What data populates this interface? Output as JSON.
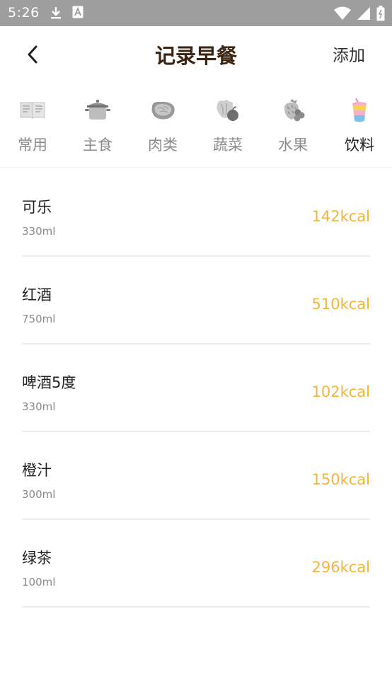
{
  "status_bar": {
    "time": "5:26",
    "left_icons": [
      "download-icon",
      "font-icon"
    ],
    "right_icons": [
      "wifi-icon",
      "signal-icon",
      "battery-icon"
    ]
  },
  "header": {
    "back_icon": "chevron-left-icon",
    "title": "记录早餐",
    "action_label": "添加"
  },
  "tabs": [
    {
      "label": "常用",
      "icon": "book-icon",
      "active": false
    },
    {
      "label": "主食",
      "icon": "rice-pot-icon",
      "active": false
    },
    {
      "label": "肉类",
      "icon": "steak-icon",
      "active": false
    },
    {
      "label": "蔬菜",
      "icon": "vegetables-icon",
      "active": false
    },
    {
      "label": "水果",
      "icon": "fruit-icon",
      "active": false
    },
    {
      "label": "饮料",
      "icon": "drink-cup-icon",
      "active": true
    }
  ],
  "foods": [
    {
      "name": "可乐",
      "portion": "330ml",
      "kcal": "142kcal"
    },
    {
      "name": "红酒",
      "portion": "750ml",
      "kcal": "510kcal"
    },
    {
      "name": "啤酒5度",
      "portion": "330ml",
      "kcal": "102kcal"
    },
    {
      "name": "橙汁",
      "portion": "300ml",
      "kcal": "150kcal"
    },
    {
      "name": "绿茶",
      "portion": "100ml",
      "kcal": "296kcal"
    }
  ],
  "colors": {
    "title": "#3b2412",
    "kcal": "#f5b43a",
    "status_bar": "#9e9e9e"
  }
}
